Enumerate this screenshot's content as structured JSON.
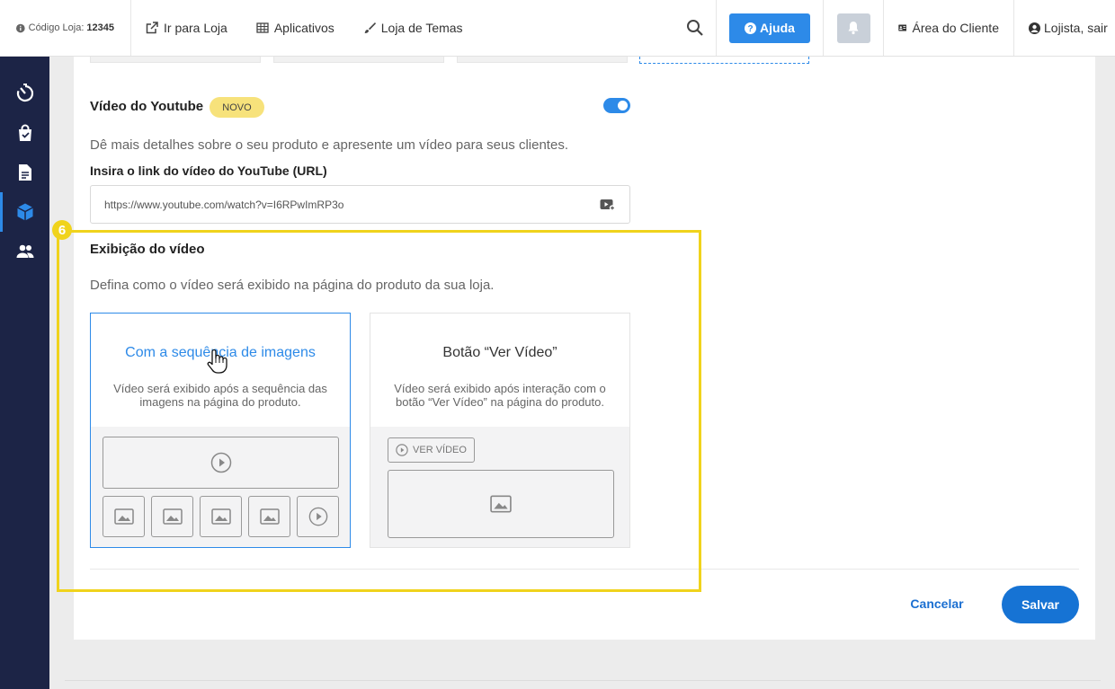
{
  "topbar": {
    "store_code_label": "Código Loja:",
    "store_code_value": "12345",
    "go_to_store": "Ir para Loja",
    "apps": "Aplicativos",
    "theme_store": "Loja de Temas",
    "help": "Ajuda",
    "client_area": "Área do Cliente",
    "user": "Lojista, sair"
  },
  "sidebar": {
    "items": [
      {
        "icon": "dashboard-icon",
        "active": false
      },
      {
        "icon": "shopping-bag-icon",
        "active": false
      },
      {
        "icon": "document-icon",
        "active": false
      },
      {
        "icon": "product-box-icon",
        "active": true
      },
      {
        "icon": "customers-icon",
        "active": false
      }
    ]
  },
  "youtube": {
    "title": "Vídeo do Youtube",
    "badge": "NOVO",
    "enabled": true,
    "description": "Dê mais detalhes sobre o seu produto e apresente um vídeo para seus clientes.",
    "url_label": "Insira o link do vídeo do YouTube (URL)",
    "url_value": "https://www.youtube.com/watch?v=I6RPwImRP3o"
  },
  "display": {
    "title": "Exibição do vídeo",
    "description": "Defina como o vídeo será exibido na página do produto da sua loja.",
    "options": [
      {
        "title": "Com a sequência de imagens",
        "description": "Vídeo será exibido após a sequência das imagens na página do produto.",
        "selected": true
      },
      {
        "title": "Botão “Ver Vídeo”",
        "description": "Vídeo será exibido após interação com o botão “Ver Vídeo” na página do produto.",
        "button_label": "VER VÍDEO",
        "selected": false
      }
    ]
  },
  "actions": {
    "cancel": "Cancelar",
    "save": "Salvar"
  },
  "annotation": {
    "step": "6"
  },
  "colors": {
    "accent": "#2d8ae8",
    "sidebar": "#1c2446",
    "highlight": "#f0d31c",
    "badge": "#f7e27b",
    "save": "#1673d4"
  }
}
